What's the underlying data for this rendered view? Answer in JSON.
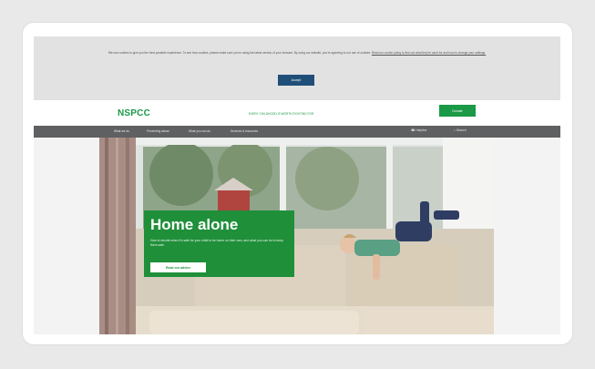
{
  "cookie_banner": {
    "text": "We use cookies to give you the best possible experience. To see how cookies, please make sure you're using the latest version of your browser. By using our website, you're agreeing to our use of cookies.",
    "link_text": "Read our cookie policy to find out what they're used for and how to change your settings.",
    "accept_label": "Accept"
  },
  "header": {
    "logo": "NSPCC",
    "helpline": "EVERY CHILDHOOD IS WORTH FIGHTING FOR",
    "donate_label": "Donate"
  },
  "nav": {
    "items": [
      "What we do",
      "Preventing abuse",
      "What you can do",
      "Services & resources"
    ],
    "helpline_label": "Helpline",
    "search_label": "Search"
  },
  "hero": {
    "title": "Home alone",
    "text": "How to decide when it's safe for your child to be home on their own, and what you can do to keep them safe.",
    "button_label": "Read our advice"
  },
  "colors": {
    "brand_green": "#1a9946",
    "nav_grey": "#5f6062",
    "accept_blue": "#1f4f78"
  }
}
